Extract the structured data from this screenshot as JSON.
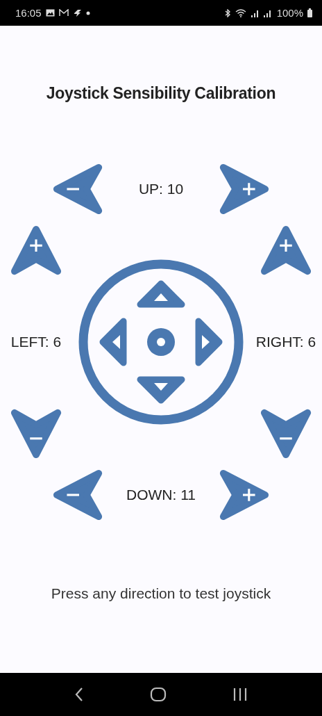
{
  "status_bar": {
    "time": "16:05",
    "battery": "100%"
  },
  "title": "Joystick Sensibility Calibration",
  "controls": [
    {
      "kind": "up",
      "label": "UP: 10"
    },
    {
      "kind": "left",
      "label": "LEFT: 6"
    },
    {
      "kind": "right",
      "label": "RIGHT: 6"
    },
    {
      "kind": "down",
      "label": "DOWN: 11"
    }
  ],
  "hint": "Press any direction to test joystick"
}
